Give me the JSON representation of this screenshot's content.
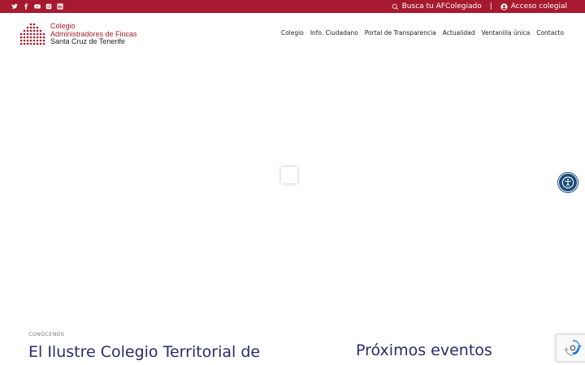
{
  "topbar": {
    "social_icons": [
      "twitter-icon",
      "facebook-icon",
      "youtube-icon",
      "instagram-icon",
      "linkedin-icon"
    ],
    "search_label": "Busca tu AFColegiado",
    "separator": "|",
    "login_label": "Acceso colegial"
  },
  "logo": {
    "line1": "Colegio",
    "line2": "Administradores de Fincas",
    "line3": "Santa Cruz de Tenerife"
  },
  "nav": {
    "items": [
      "Colegio",
      "Info. Ciudadano",
      "Portal de Transparencia",
      "Actualidad",
      "Ventanilla única",
      "Contacto"
    ]
  },
  "content": {
    "kicker": "CONÓCENOS",
    "title": "El Ilustre Colegio Territorial de",
    "events_title": "Próximos eventos"
  },
  "colors": {
    "brand_red": "#a6192e",
    "heading_navy": "#2a2a6e",
    "accessibility_blue": "#1c4b7b"
  }
}
